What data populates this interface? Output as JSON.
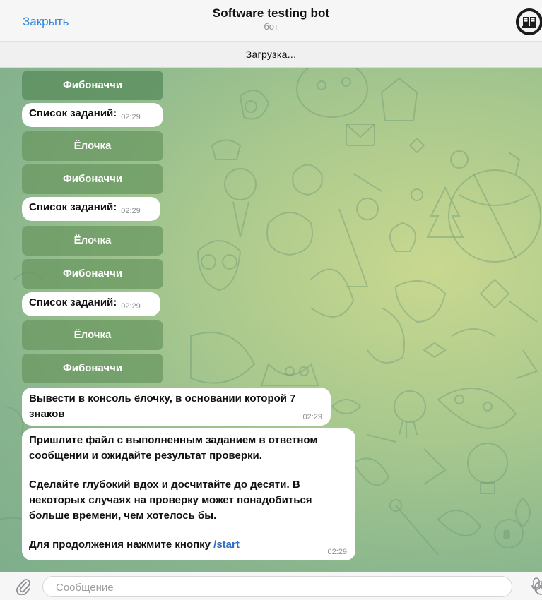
{
  "header": {
    "close_label": "Закрыть",
    "title": "Software testing bot",
    "subtitle": "бот"
  },
  "status_bar": {
    "loading_text": "Загрузка..."
  },
  "chat": {
    "keyboard_buttons": {
      "fibonacci": "Фибоначчи",
      "tree": "Ёлочка"
    },
    "task_list_messages": [
      {
        "text": "Список заданий:",
        "time": "02:29"
      },
      {
        "text": "Список заданий:",
        "time": "02:29"
      },
      {
        "text": "Список заданий:",
        "time": "02:29"
      }
    ],
    "task_message": {
      "text": "Вывести в консоль ёлочку, в основании которой 7 знаков",
      "time": "02:29"
    },
    "instruction_message": {
      "paragraph1": "Пришлите файл с выполненным заданием в ответном сообщении и ожидайте результат проверки.",
      "paragraph2": "Сделайте глубокий вдох и досчитайте до десяти. В некоторых случаях на проверку может понадобиться больше времени, чем хотелось бы.",
      "paragraph3_prefix": "Для продолжения нажмите кнопку ",
      "command": "/start",
      "time": "02:29"
    }
  },
  "input": {
    "placeholder": "Сообщение"
  },
  "icons": {
    "attach": "paperclip-icon",
    "sticker": "sticker-icon",
    "mic": "microphone-icon",
    "avatar": "bot-avatar"
  },
  "colors": {
    "link": "#2f86d8",
    "keyboard_button": "#588c5c",
    "wallpaper_light": "#c9d88f",
    "wallpaper_dark": "#7fae8c"
  }
}
